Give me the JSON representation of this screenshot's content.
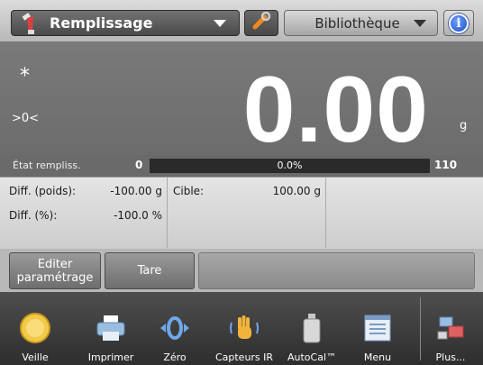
{
  "header": {
    "mode_label": "Remplissage",
    "library_label": "Bibliothèque"
  },
  "display": {
    "stable_indicator": "*",
    "zero_indicator": ">0<",
    "weight": "0.00",
    "unit": "g"
  },
  "progress": {
    "label": "État rempliss.",
    "min": "0",
    "max": "110",
    "percent_text": "0.0%",
    "fill_fraction": 0.0
  },
  "info": {
    "diff_weight_label": "Diff. (poids):",
    "diff_weight_value": "-100.00 g",
    "diff_pct_label": "Diff. (%):",
    "diff_pct_value": "-100.0 %",
    "target_label": "Cible:",
    "target_value": "100.00 g"
  },
  "actions": {
    "edit_settings": "Editer paramétrage",
    "tare": "Tare"
  },
  "toolbar": {
    "standby": "Veille",
    "print": "Imprimer",
    "zero": "Zéro",
    "ir_sensors": "Capteurs IR",
    "autocal": "AutoCal™",
    "menu": "Menu",
    "more": "Plus..."
  },
  "icons": {
    "mode": "funnel-icon",
    "tool": "wrench-icon",
    "info": "info-icon",
    "standby": "power-icon",
    "print": "printer-icon",
    "zero": "zero-icon",
    "ir_sensors": "hand-icon",
    "autocal": "weight-icon",
    "menu": "menu-icon",
    "more": "more-icon"
  },
  "colors": {
    "progress_fill": "#5fb24a",
    "info_blue": "#1c4fc4",
    "display_bg": "#727272"
  }
}
